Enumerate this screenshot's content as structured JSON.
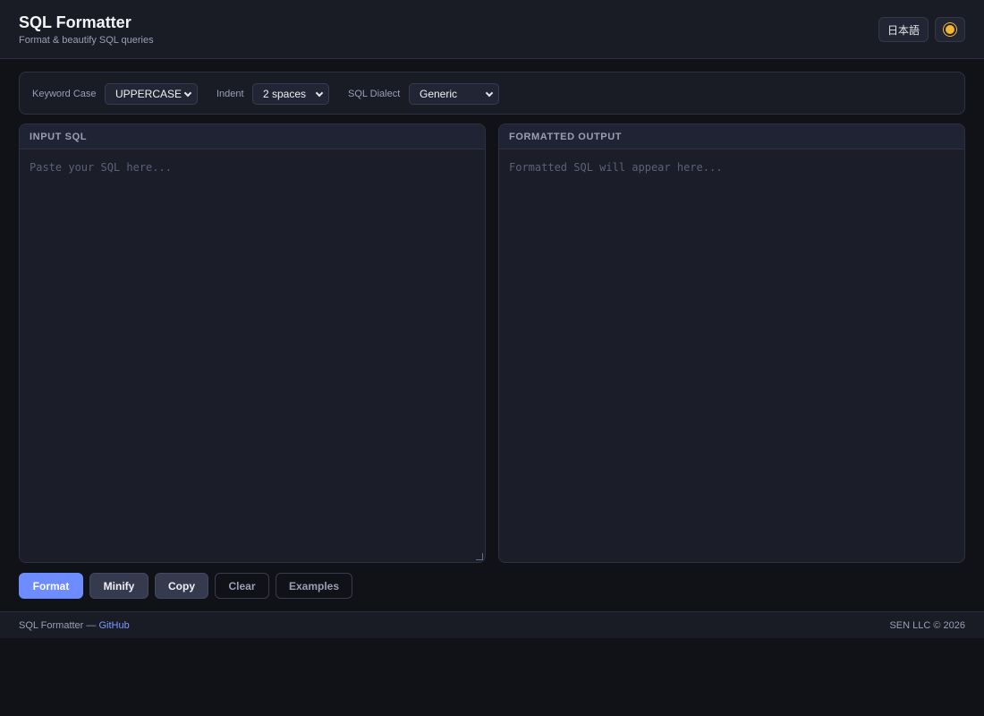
{
  "header": {
    "title": "SQL Formatter",
    "subtitle": "Format & beautify SQL queries",
    "lang_button": "日本語",
    "theme_icon": "sun-icon"
  },
  "toolbar": {
    "keyword_case": {
      "label": "Keyword Case",
      "value": "UPPERCASE"
    },
    "indent": {
      "label": "Indent",
      "value": "2 spaces"
    },
    "dialect": {
      "label": "SQL Dialect",
      "value": "Generic"
    }
  },
  "input_panel": {
    "title": "INPUT SQL",
    "placeholder": "Paste your SQL here...",
    "value": ""
  },
  "output_panel": {
    "title": "FORMATTED OUTPUT",
    "placeholder": "Formatted SQL will appear here..."
  },
  "actions": {
    "format": "Format",
    "minify": "Minify",
    "copy": "Copy",
    "clear": "Clear",
    "examples": "Examples"
  },
  "footer": {
    "left_text": "SQL Formatter —",
    "link": "GitHub",
    "right_text": "SEN LLC © 2026"
  },
  "colors": {
    "accent": "#6c8cff",
    "background": "#111218",
    "panel": "#1b1d28",
    "link": "#7c9bff"
  }
}
